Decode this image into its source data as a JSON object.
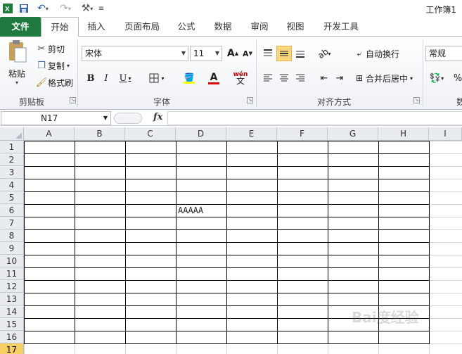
{
  "title_bar": {
    "document_title": "工作簿1"
  },
  "tabs": [
    {
      "label": "文件"
    },
    {
      "label": "开始"
    },
    {
      "label": "插入"
    },
    {
      "label": "页面布局"
    },
    {
      "label": "公式"
    },
    {
      "label": "数据"
    },
    {
      "label": "审阅"
    },
    {
      "label": "视图"
    },
    {
      "label": "开发工具"
    }
  ],
  "clipboard": {
    "paste": "粘贴",
    "cut": "剪切",
    "copy": "复制",
    "format_painter": "格式刷",
    "group": "剪贴板"
  },
  "font": {
    "name": "宋体",
    "size": "11",
    "group": "字体"
  },
  "alignment": {
    "wrap": "自动换行",
    "merge": "合并后居中",
    "group": "对齐方式"
  },
  "number": {
    "format": "常规",
    "percent": "%",
    "group_partial": "数"
  },
  "formula_bar": {
    "name_box": "N17",
    "fx": "fx",
    "value": ""
  },
  "columns": [
    "A",
    "B",
    "C",
    "D",
    "E",
    "F",
    "G",
    "H",
    "I"
  ],
  "rows": [
    "1",
    "2",
    "3",
    "4",
    "5",
    "6",
    "7",
    "8",
    "9",
    "10",
    "11",
    "12",
    "13",
    "14",
    "15",
    "16",
    "17"
  ],
  "selected_row": "17",
  "cells": {
    "D6": "AAAAA"
  },
  "colors": {
    "file_tab": "#1f7a3f",
    "header_bg": "#e8ecf1",
    "selected_header": "#f6cf63",
    "font_color_bar": "#e00000",
    "fill_color_bar": "#ffff00"
  }
}
